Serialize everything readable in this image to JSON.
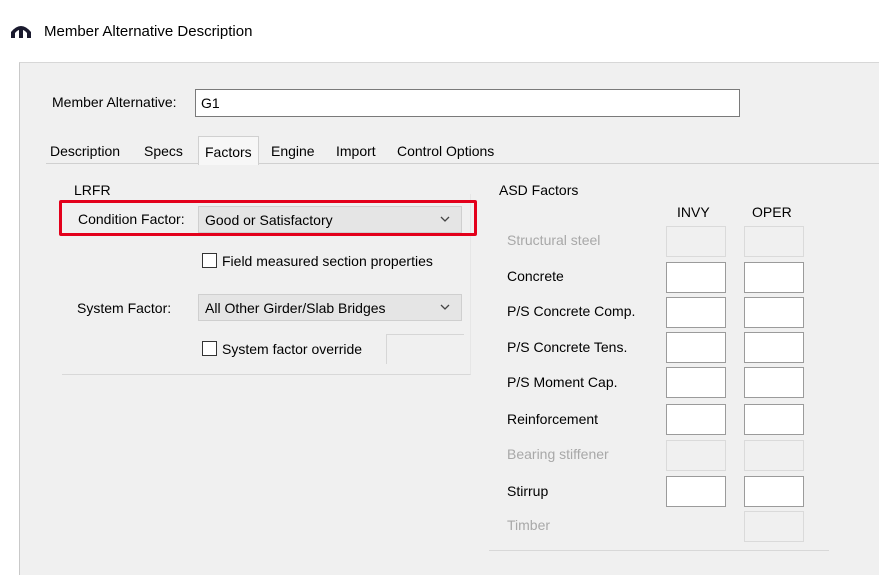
{
  "window": {
    "title": "Member Alternative Description"
  },
  "member_alternative": {
    "label": "Member Alternative:",
    "value": "G1"
  },
  "tabs": [
    {
      "label": "Description"
    },
    {
      "label": "Specs"
    },
    {
      "label": "Factors"
    },
    {
      "label": "Engine"
    },
    {
      "label": "Import"
    },
    {
      "label": "Control Options"
    }
  ],
  "active_tab": "Factors",
  "lrfr": {
    "title": "LRFR",
    "condition_factor": {
      "label": "Condition Factor:",
      "value": "Good or Satisfactory"
    },
    "field_measured": {
      "label": "Field measured section properties",
      "checked": false
    },
    "system_factor": {
      "label": "System Factor:",
      "value": "All Other Girder/Slab Bridges"
    },
    "system_override": {
      "label": "System factor override",
      "checked": false
    }
  },
  "asd": {
    "title": "ASD Factors",
    "col_invy": "INVY",
    "col_oper": "OPER",
    "rows": [
      {
        "label": "Structural steel",
        "enabled": false
      },
      {
        "label": "Concrete",
        "enabled": true
      },
      {
        "label": "P/S Concrete Comp.",
        "enabled": true
      },
      {
        "label": "P/S Concrete Tens.",
        "enabled": true
      },
      {
        "label": "P/S Moment Cap.",
        "enabled": true
      },
      {
        "label": "Reinforcement",
        "enabled": true
      },
      {
        "label": "Bearing stiffener",
        "enabled": false
      },
      {
        "label": "Stirrup",
        "enabled": true
      },
      {
        "label": "Timber",
        "enabled": false
      }
    ]
  },
  "colors": {
    "highlight": "#e3001b",
    "window_bg": "#f0f0f0"
  }
}
